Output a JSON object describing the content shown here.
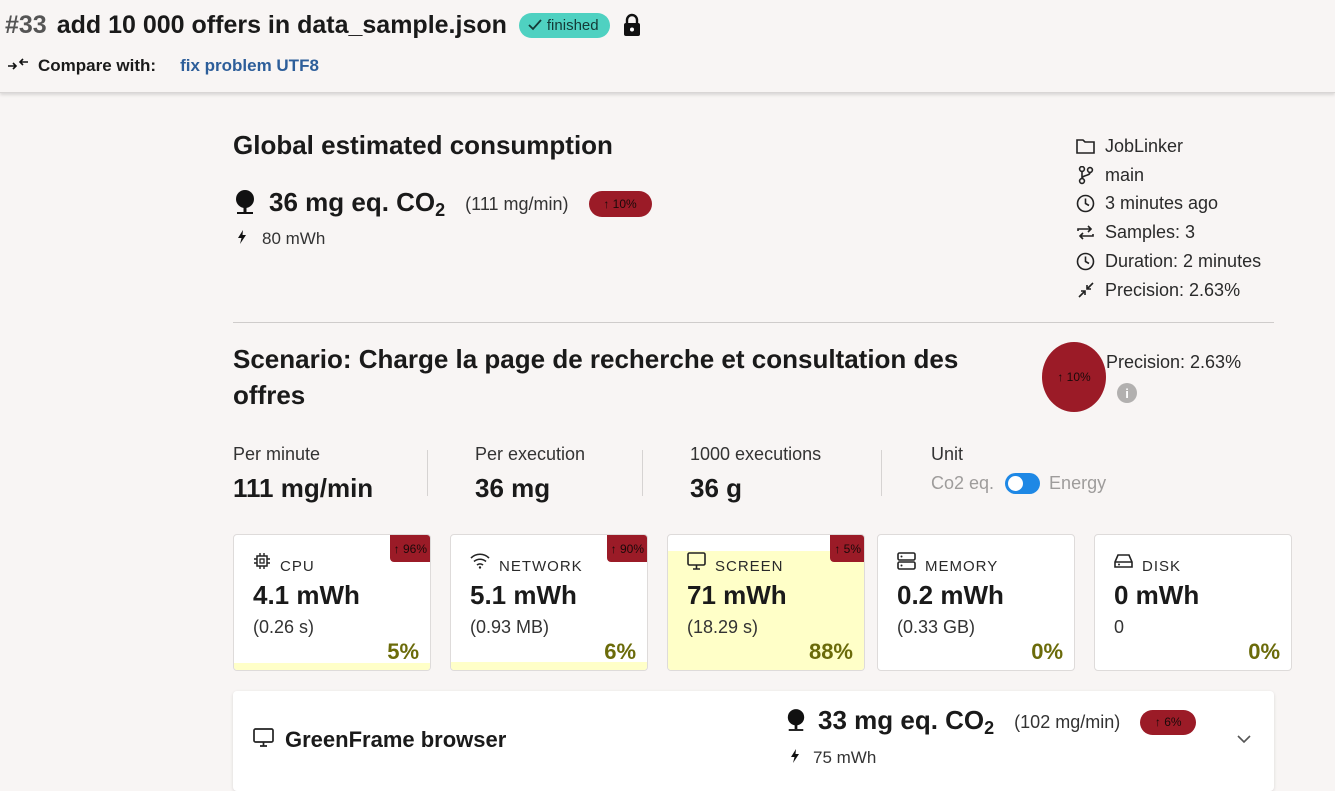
{
  "header": {
    "run_number": "#33",
    "run_title": "add 10 000 offers in data_sample.json",
    "status": "finished",
    "compare_label": "Compare with:",
    "compare_link": "fix problem UTF8"
  },
  "global": {
    "title": "Global estimated consumption",
    "co2_value": "36 mg eq. CO",
    "co2_sub": "2",
    "co2_rate": "(111 mg/min)",
    "trend": "↑ 10%",
    "energy": "80 mWh"
  },
  "meta": [
    {
      "icon": "folder-icon",
      "text": "JobLinker"
    },
    {
      "icon": "branch-icon",
      "text": "main"
    },
    {
      "icon": "clock-icon",
      "text": "3 minutes ago"
    },
    {
      "icon": "repeat-icon",
      "text": "Samples: 3"
    },
    {
      "icon": "clock-icon",
      "text": "Duration: 2 minutes"
    },
    {
      "icon": "compress-icon",
      "text": "Precision: 2.63%"
    }
  ],
  "scenario": {
    "title": "Scenario: Charge la page de recherche et consultation des offres",
    "trend": "↑ 10%",
    "precision": "Precision: 2.63%",
    "info": "i",
    "stats": [
      {
        "label": "Per minute",
        "value": "111 mg/min"
      },
      {
        "label": "Per execution",
        "value": "36 mg"
      },
      {
        "label": "1000 executions",
        "value": "36 g"
      }
    ],
    "unit_label": "Unit",
    "unit_left": "Co2 eq.",
    "unit_right": "Energy",
    "unit_selected": "Energy"
  },
  "cards": [
    {
      "icon": "cpu-icon",
      "label": "CPU",
      "value": "4.1 mWh",
      "sub": "(0.26 s)",
      "pct": "5%",
      "fill": 0.05,
      "trend": "↑ 96%"
    },
    {
      "icon": "wifi-icon",
      "label": "NETWORK",
      "value": "5.1 mWh",
      "sub": "(0.93 MB)",
      "pct": "6%",
      "fill": 0.06,
      "trend": "↑ 90%"
    },
    {
      "icon": "monitor-icon",
      "label": "SCREEN",
      "value": "71 mWh",
      "sub": "(18.29 s)",
      "pct": "88%",
      "fill": 0.88,
      "trend": "↑ 5%"
    },
    {
      "icon": "memory-icon",
      "label": "MEMORY",
      "value": "0.2 mWh",
      "sub": "(0.33 GB)",
      "pct": "0%",
      "fill": 0,
      "trend": ""
    },
    {
      "icon": "disk-icon",
      "label": "DISK",
      "value": "0 mWh",
      "sub": "0",
      "pct": "0%",
      "fill": 0,
      "trend": ""
    }
  ],
  "browser": {
    "label": "GreenFrame browser",
    "co2_value": "33 mg eq. CO",
    "co2_sub": "2",
    "co2_rate": "(102 mg/min)",
    "trend": "↑ 6%",
    "energy": "75 mWh"
  },
  "colors": {
    "background": "#f8f5f4",
    "status_badge": "#4fd1c1",
    "trend_red": "#9b1b27",
    "link": "#2d5e9a",
    "toggle": "#1e88e5",
    "fill_yellow": "#ffffc8"
  }
}
